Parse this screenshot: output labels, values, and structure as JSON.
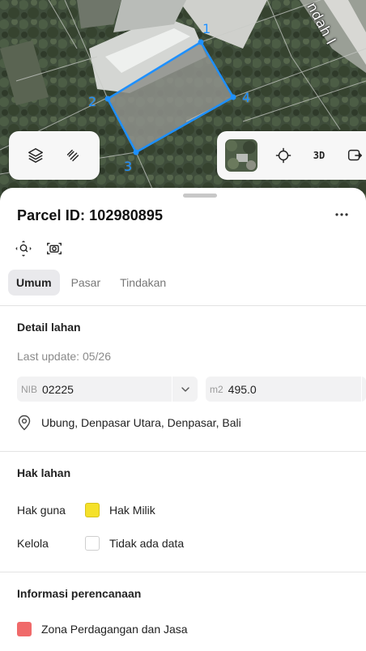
{
  "map": {
    "street_label": "ndah I",
    "vertices": [
      "1",
      "2",
      "3",
      "4"
    ],
    "controls": {
      "layers_icon": "layers-icon",
      "draw_icon": "draw-tool-icon",
      "locate_icon": "crosshair-icon",
      "view_3d_label": "3D",
      "overflow_icon": "share-icon"
    }
  },
  "parcel": {
    "title": "Parcel ID: 102980895",
    "more_label": "···",
    "actions": [
      "zoom-to-parcel-icon",
      "camera-icon"
    ]
  },
  "tabs": [
    {
      "label": "Umum",
      "active": true
    },
    {
      "label": "Pasar",
      "active": false
    },
    {
      "label": "Tindakan",
      "active": false
    }
  ],
  "detail": {
    "title": "Detail lahan",
    "last_update": "Last update: 05/26",
    "nib_prefix": "NIB",
    "nib_value": "02225",
    "area_prefix": "m2",
    "area_value": "495.0",
    "location": "Ubung, Denpasar Utara, Denpasar, Bali"
  },
  "rights": {
    "title": "Hak lahan",
    "rows": [
      {
        "label": "Hak guna",
        "value": "Hak Milik",
        "color": "#f5e12a"
      },
      {
        "label": "Kelola",
        "value": "Tidak ada data",
        "color": "#ffffff"
      }
    ]
  },
  "planning": {
    "title": "Informasi perencanaan",
    "zone": "Zona Perdagangan dan Jasa",
    "zone_color": "#f06a6a"
  },
  "colors": {
    "parcel_outline": "#1e90ff",
    "sheet_bg": "#ffffff",
    "tab_active_bg": "#e9e9ec"
  }
}
